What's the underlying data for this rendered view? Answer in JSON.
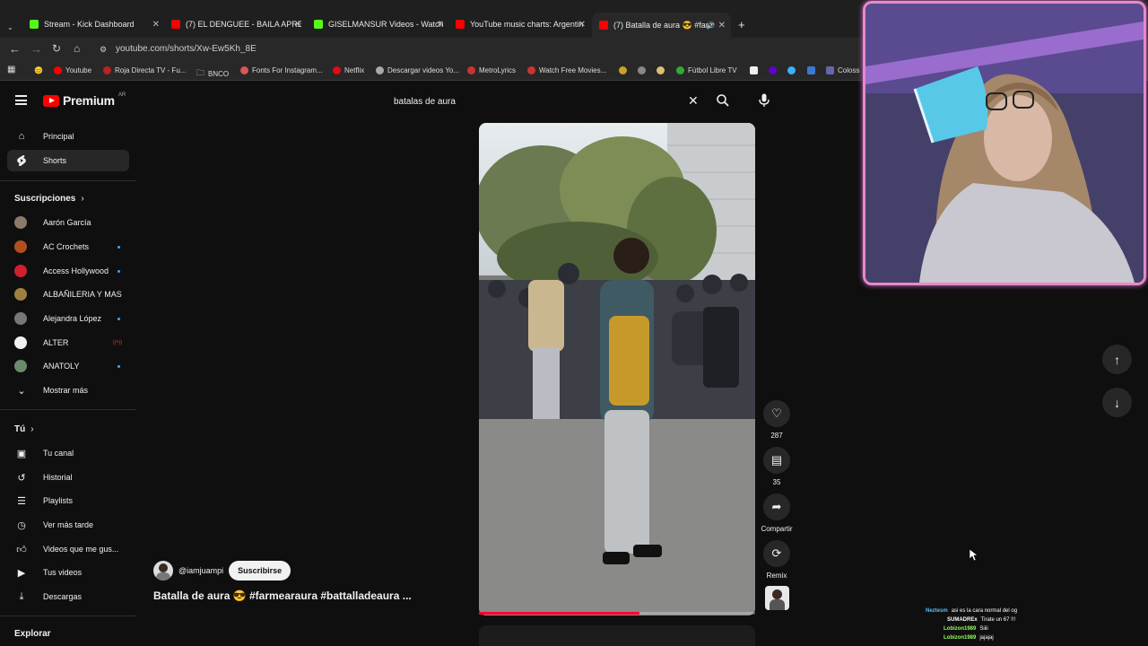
{
  "browser": {
    "tabs": [
      {
        "label": "Stream - Kick Dashboard",
        "color": "#53fc18"
      },
      {
        "label": "(7) EL DENGUEE - BAILA APRET",
        "color": "#ff0000"
      },
      {
        "label": "GISELMANSUR Videos - Watch",
        "color": "#53fc18"
      },
      {
        "label": "YouTube music charts: Argentin",
        "color": "#ff0000"
      },
      {
        "label": "(7) Batalla de aura 😎 #farm",
        "color": "#ff0000"
      }
    ],
    "new_tab": "+",
    "url": "youtube.com/shorts/Xw-Ew5Kh_8E",
    "bookmarks": [
      {
        "label": "Youtube",
        "color": "#ff0000"
      },
      {
        "label": "Roja Directa TV - Fu...",
        "color": "#b22"
      },
      {
        "label": "BNCO",
        "color": "#999"
      },
      {
        "label": "Fonts For Instagram...",
        "color": "#d55"
      },
      {
        "label": "Netflix",
        "color": "#e50914"
      },
      {
        "label": "Descargar videos Yo...",
        "color": "#aaa"
      },
      {
        "label": "MetroLyrics",
        "color": "#c33"
      },
      {
        "label": "Watch Free Movies...",
        "color": "#c33"
      },
      {
        "label": "Fútbol Libre TV",
        "color": "#3a3"
      },
      {
        "label": "Coloss",
        "color": "#66a"
      }
    ]
  },
  "youtube": {
    "logo_text": "Premium",
    "region": "AR",
    "search": {
      "value": "batalas de aura"
    },
    "sidebar": {
      "main": [
        {
          "label": "Principal",
          "icon": "home-icon"
        },
        {
          "label": "Shorts",
          "icon": "shorts-icon"
        }
      ],
      "subscriptions_title": "Suscripciones",
      "subscriptions": [
        {
          "label": "Aarón García",
          "color": "#8a7a6a",
          "dot": false
        },
        {
          "label": "AC Crochets",
          "color": "#b05020",
          "dot": true
        },
        {
          "label": "Access Hollywood",
          "color": "#d02030",
          "dot": true
        },
        {
          "label": "ALBAÑILERIA Y MAS",
          "color": "#a08040",
          "dot": false
        },
        {
          "label": "Alejandra López",
          "color": "#777",
          "dot": true
        },
        {
          "label": "ALTER",
          "color": "#f1f1f1",
          "live": true
        },
        {
          "label": "ANATOLY",
          "color": "#6a8a6a",
          "dot": true
        }
      ],
      "show_more": "Mostrar más",
      "you_title": "Tú",
      "you": [
        {
          "label": "Tu canal",
          "icon": "channel-icon"
        },
        {
          "label": "Historial",
          "icon": "history-icon"
        },
        {
          "label": "Playlists",
          "icon": "playlist-icon"
        },
        {
          "label": "Ver más tarde",
          "icon": "clock-icon"
        },
        {
          "label": "Videos que me gus...",
          "icon": "thumbs-up-icon"
        },
        {
          "label": "Tus videos",
          "icon": "video-icon"
        },
        {
          "label": "Descargas",
          "icon": "download-icon"
        }
      ],
      "explore_title": "Explorar"
    },
    "short": {
      "channel": "@iamjuampi",
      "subscribe_label": "Suscribirse",
      "title": "Batalla de aura 😎 #farmearaura #battalladeaura ...",
      "likes": "287",
      "comments": "35",
      "share_label": "Compartir",
      "remix_label": "Remix",
      "progress": 0.58
    }
  },
  "stream_chat": [
    {
      "user": "Neztesm",
      "msg": "asi es la cara normal del og",
      "color": "#5bc0ff"
    },
    {
      "user": "SUMADREx",
      "msg": "Tirate un 67 !!!",
      "color": "#ffffff"
    },
    {
      "user": "Lobizon1989",
      "msg": "Siiii",
      "color": "#8cff5a"
    },
    {
      "user": "Lobizon1989",
      "msg": "jajajaj",
      "color": "#8cff5a"
    }
  ]
}
